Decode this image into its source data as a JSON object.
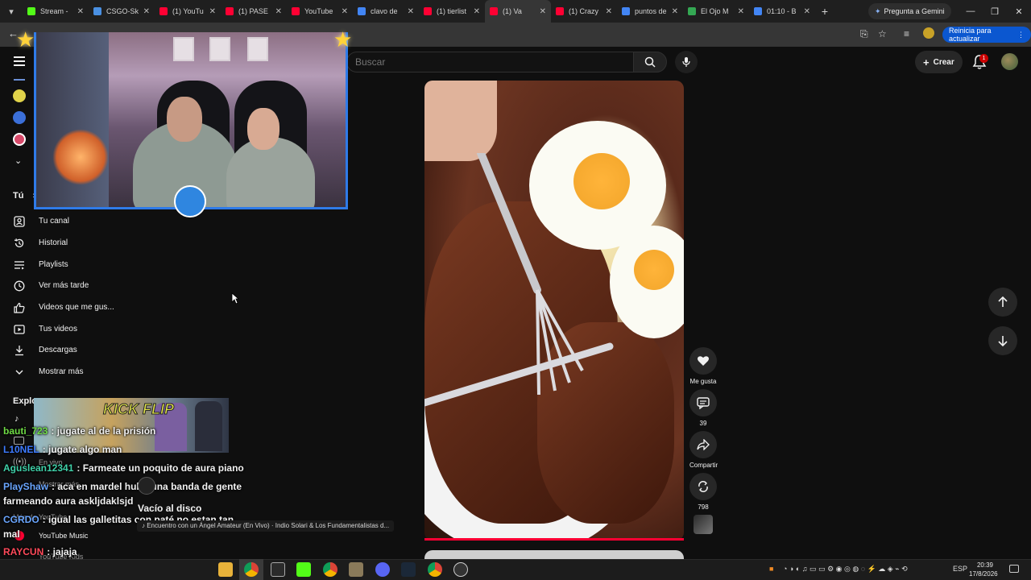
{
  "browser": {
    "tabs": [
      {
        "label": "Stream -",
        "color": "#53fc18"
      },
      {
        "label": "CSGO-Sk",
        "color": "#4a90e2"
      },
      {
        "label": "(1) YouTu",
        "color": "#ff0033"
      },
      {
        "label": "(1) PASE",
        "color": "#ff0033"
      },
      {
        "label": "YouTube",
        "color": "#ff0033"
      },
      {
        "label": "clavo de",
        "color": "#4285f4"
      },
      {
        "label": "(1) tierlist",
        "color": "#ff0033"
      },
      {
        "label": "(1) Va",
        "color": "#ff0033"
      },
      {
        "label": "(1) Crazy",
        "color": "#ff0033"
      },
      {
        "label": "puntos de",
        "color": "#4285f4"
      },
      {
        "label": "El Ojo M",
        "color": "#34a853"
      },
      {
        "label": "01:10 - B",
        "color": "#4285f4"
      }
    ],
    "active_tab_index": 7,
    "gemini_label": "Pregunta a Gemini",
    "update_label": "Reinicia para actualizar"
  },
  "header": {
    "search_placeholder": "Buscar",
    "create_label": "Crear",
    "notifications_count": "1"
  },
  "sidebar": {
    "you_label": "Tú",
    "items": [
      {
        "label": "Tu canal",
        "icon": "channel-icon"
      },
      {
        "label": "Historial",
        "icon": "history-icon"
      },
      {
        "label": "Playlists",
        "icon": "playlist-icon"
      },
      {
        "label": "Ver más tarde",
        "icon": "clock-icon"
      },
      {
        "label": "Videos que me gus...",
        "icon": "thumb-up-icon"
      },
      {
        "label": "Tus videos",
        "icon": "video-icon"
      },
      {
        "label": "Descargas",
        "icon": "download-icon"
      },
      {
        "label": "Mostrar más",
        "icon": "chevron-down-icon"
      }
    ],
    "explore_label": "Explo",
    "explore_items": [
      {
        "label": "En vivo"
      },
      {
        "label": "Mostrar más"
      },
      {
        "label": "Más de YouTube"
      },
      {
        "label": "YouTube Music"
      },
      {
        "label": "YouTube Kids"
      }
    ]
  },
  "short": {
    "like_label": "Me gusta",
    "comments_count": "39",
    "share_label": "Compartir",
    "remix_count": "798"
  },
  "overlay": {
    "game_title": "KICK FLIP",
    "chat": [
      {
        "user": "bauti_723",
        "user_color": "#6fdc45",
        "text": ": jugate al de la prisión"
      },
      {
        "user": "L10NEL",
        "user_color": "#3d7bff",
        "text": ": jugate algo man"
      },
      {
        "user": "Aguslean12341",
        "user_color": "#3fd0a8",
        "text": ": Farmeate un poquito de aura piano"
      },
      {
        "user": "PlayShaw",
        "user_color": "#6aa6ff",
        "text": ": aca en mardel hubo una banda de gente"
      },
      {
        "user": "",
        "user_color": "#ffffff",
        "text": "farmeando aura askljdaklsjd"
      },
      {
        "user": "CGRDO",
        "user_color": "#6aa6ff",
        "text": ": igual las galletitas con paté no estan tan"
      },
      {
        "user": "",
        "user_color": "#ffffff",
        "text": "mal"
      },
      {
        "user": "RAYCUN",
        "user_color": "#ff4a5a",
        "text": ": jajaja"
      },
      {
        "user": "bauti_723",
        "user_color": "#6fdc45",
        "text": ": piano jugate al de la prisión"
      }
    ],
    "now_playing_title": "Vacío al disco",
    "song": "♪ Encuentro con un Ángel Amateur (En Vivo) · Indio Solari & Los Fundamentalistas d..."
  },
  "taskbar": {
    "lang": "ESP",
    "time": "20:39",
    "date": "17/8/2026"
  }
}
